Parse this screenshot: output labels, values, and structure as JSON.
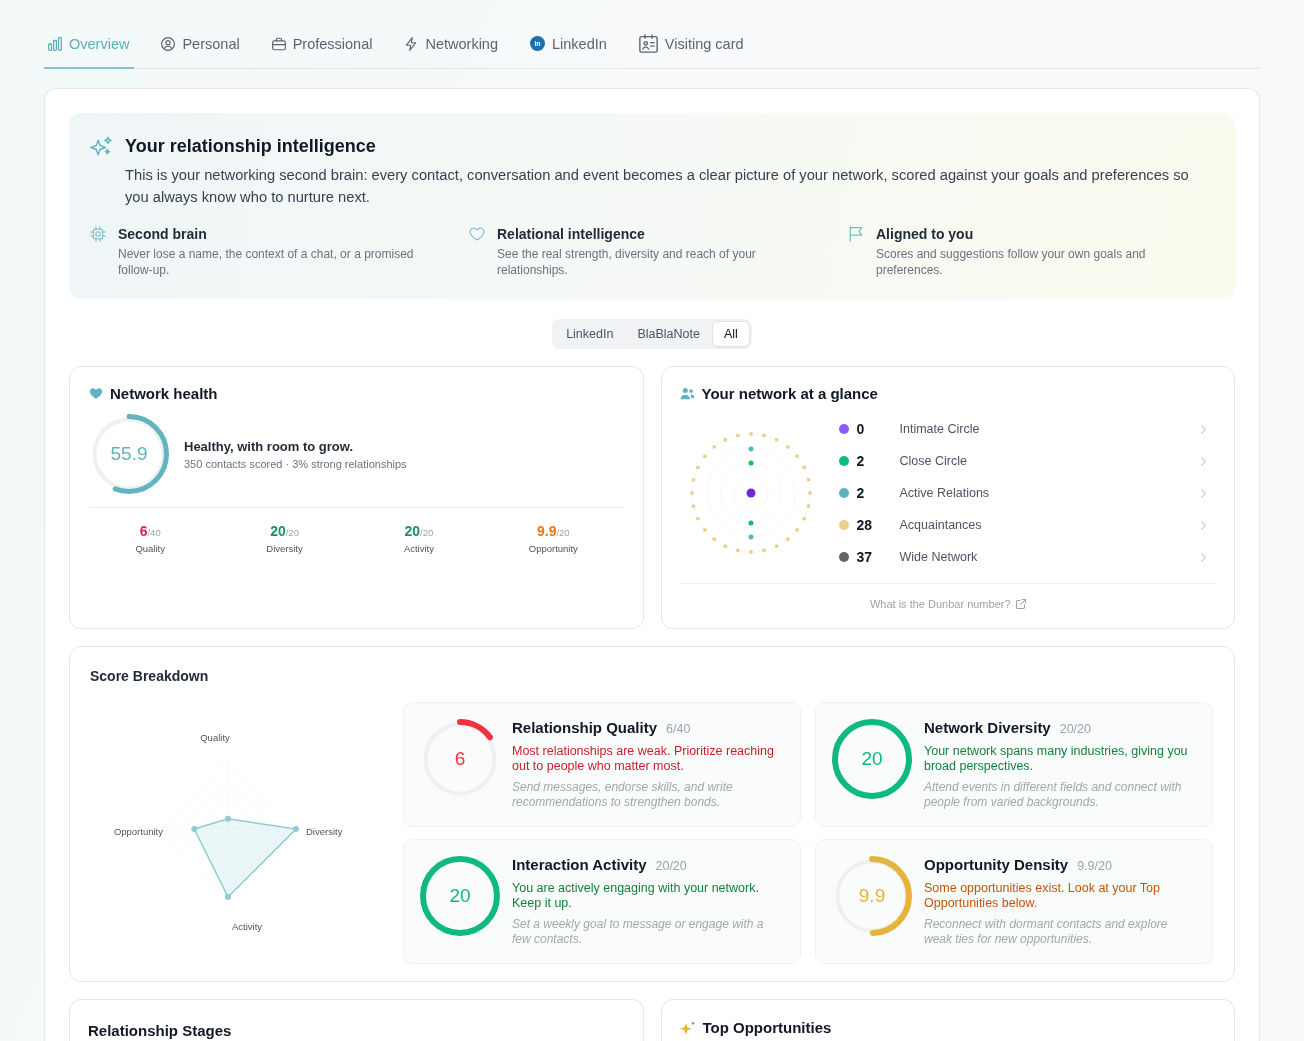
{
  "tabs": [
    {
      "label": "Overview",
      "selected": true
    },
    {
      "label": "Personal",
      "selected": false
    },
    {
      "label": "Professional",
      "selected": false
    },
    {
      "label": "Networking",
      "selected": false
    },
    {
      "label": "LinkedIn",
      "logo_text": "in",
      "selected": false
    },
    {
      "label": "Visiting card",
      "selected": false
    }
  ],
  "intro": {
    "title": "Your relationship intelligence",
    "text": "This is your networking second brain: every contact, conversation and event becomes a clear picture of your network, scored against your goals and preferences so you always know who to nurture next.",
    "features": [
      {
        "title": "Second brain",
        "text": "Never lose a name, the context of a chat, or a promised follow-up."
      },
      {
        "title": "Relational intelligence",
        "text": "See the real strength, diversity and reach of your relationships."
      },
      {
        "title": "Aligned to you",
        "text": "Scores and suggestions follow your own goals and preferences."
      }
    ]
  },
  "source_filter": [
    {
      "label": "LinkedIn",
      "selected": false
    },
    {
      "label": "BlaBlaNote",
      "selected": false
    },
    {
      "label": "All",
      "selected": true
    }
  ],
  "network_health": {
    "title": "Network health",
    "score": "55.9",
    "level": 0.559,
    "headline": "Healthy, with room to grow.",
    "summary": "350 contacts scored · 3% strong relationships",
    "metrics": [
      {
        "value": "6",
        "max": "/40",
        "label": "Quality"
      },
      {
        "value": "20",
        "max": "/20",
        "label": "Diversity"
      },
      {
        "value": "20",
        "max": "/20",
        "label": "Activity"
      },
      {
        "value": "9.9",
        "max": "/20",
        "label": "Opportunity"
      }
    ]
  },
  "glance": {
    "title": "Your network at a glance",
    "circles": [
      {
        "count": "0",
        "label": "Intimate Circle",
        "color": "#8b5cf6"
      },
      {
        "count": "2",
        "label": "Close Circle",
        "color": "#10b981"
      },
      {
        "count": "2",
        "label": "Active Relations",
        "color": "#5fb3bf"
      },
      {
        "count": "28",
        "label": "Acquaintances",
        "color": "#ebcf88"
      },
      {
        "count": "37",
        "label": "Wide Network",
        "color": "#636363"
      }
    ],
    "link": "What is the Dunbar number?"
  },
  "score_breakdown": {
    "title": "Score Breakdown",
    "radar_axes": [
      "Quality",
      "Diversity",
      "Activity",
      "Opportunity"
    ],
    "cards": [
      {
        "title": "Relationship Quality",
        "fraction": "6/40",
        "value": "6",
        "level": 0.15,
        "message": "Most relationships are weak. Prioritize reaching out to people who matter most.",
        "tip": "Send messages, endorse skills, and write recommendations to strengthen bonds."
      },
      {
        "title": "Network Diversity",
        "fraction": "20/20",
        "value": "20",
        "level": 1,
        "message": "Your network spans many industries, giving you broad perspectives.",
        "tip": "Attend events in different fields and connect with people from varied backgrounds."
      },
      {
        "title": "Interaction Activity",
        "fraction": "20/20",
        "value": "20",
        "level": 1,
        "message": "You are actively engaging with your network. Keep it up.",
        "tip": "Set a weekly goal to message or engage with a few contacts."
      },
      {
        "title": "Opportunity Density",
        "fraction": "9.9/20",
        "value": "9.9",
        "level": 0.495,
        "message": "Some opportunities exist. Look at your Top Opportunities below.",
        "tip": "Reconnect with dormant contacts and explore weak ties for new opportunities."
      }
    ]
  },
  "sections": [
    {
      "title": "Relationship Stages"
    },
    {
      "title": "Top Opportunities"
    }
  ]
}
